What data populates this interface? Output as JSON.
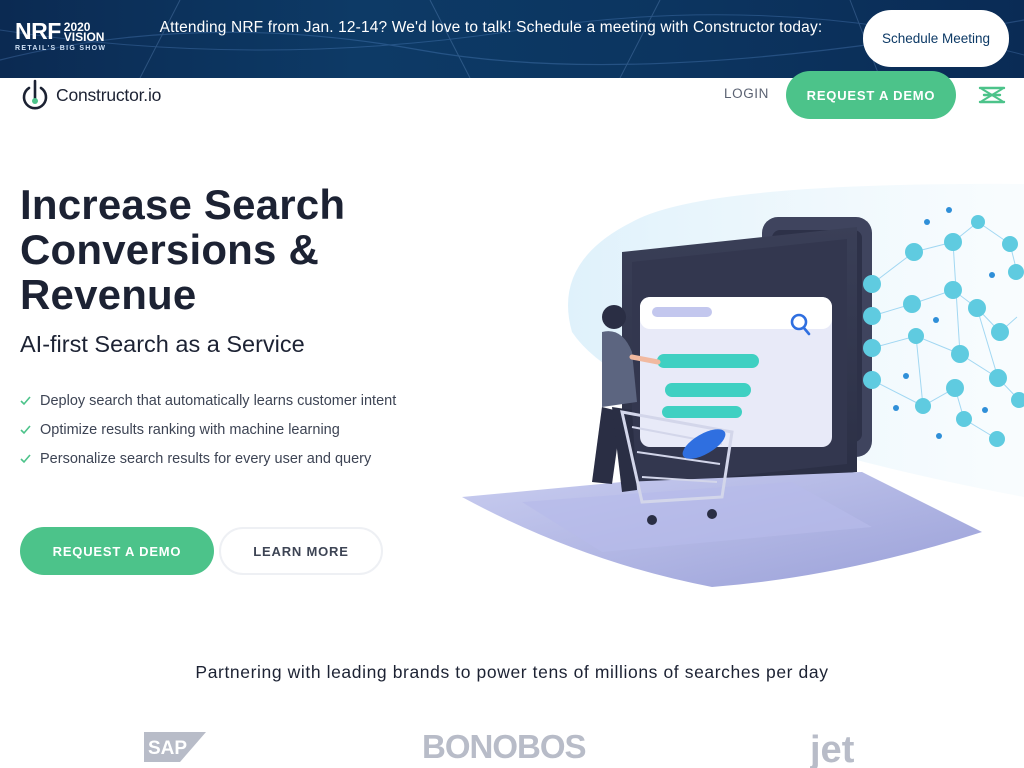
{
  "banner": {
    "logo_main": "NRF",
    "logo_year": "2020",
    "logo_word": "VISION",
    "logo_tagline": "RETAIL'S BIG SHOW",
    "message": "Attending NRF from Jan. 12-14? We'd love to talk! Schedule a meeting with Constructor today:",
    "button_label": "Schedule Meeting"
  },
  "nav": {
    "logo_text": "Constructor.io",
    "login_label": "LOGIN",
    "demo_label": "REQUEST A DEMO",
    "menu_icon": "menu-icon"
  },
  "hero": {
    "title": "Increase Search Conversions & Revenue",
    "subtitle": "AI-first Search as a Service",
    "bullets": [
      "Deploy search that automatically learns customer intent",
      "Optimize results ranking with machine learning",
      "Personalize search results for every user and query"
    ],
    "primary_cta": "REQUEST A DEMO",
    "secondary_cta": "LEARN MORE"
  },
  "partners": {
    "title": "Partnering with leading brands to power tens of millions of searches per day",
    "logos": [
      "SAP",
      "BONOBOS",
      "jet"
    ]
  },
  "colors": {
    "banner_bg": "#0d3a66",
    "accent_green": "#4cc38a",
    "text_dark": "#1c2233",
    "text_muted": "#5b6272"
  }
}
